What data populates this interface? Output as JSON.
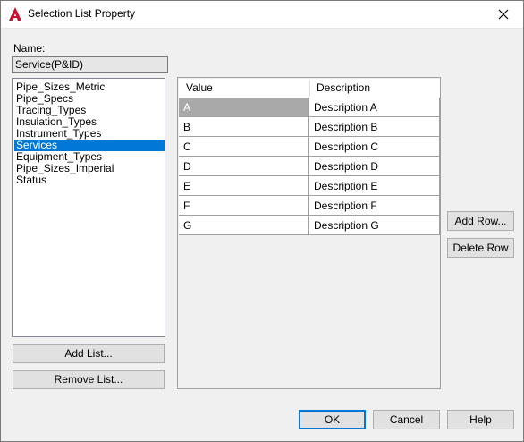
{
  "window": {
    "title": "Selection List Property"
  },
  "name_label": "Name:",
  "name_value": "Service(P&ID)",
  "lists": [
    {
      "label": "Pipe_Sizes_Metric",
      "selected": false
    },
    {
      "label": "Pipe_Specs",
      "selected": false
    },
    {
      "label": "Tracing_Types",
      "selected": false
    },
    {
      "label": "Insulation_Types",
      "selected": false
    },
    {
      "label": "Instrument_Types",
      "selected": false
    },
    {
      "label": "Services",
      "selected": true
    },
    {
      "label": "Equipment_Types",
      "selected": false
    },
    {
      "label": "Pipe_Sizes_Imperial",
      "selected": false
    },
    {
      "label": "Status",
      "selected": false
    }
  ],
  "buttons": {
    "add_list": "Add List...",
    "remove_list": "Remove List...",
    "add_row": "Add Row...",
    "delete_row": "Delete Row",
    "ok": "OK",
    "cancel": "Cancel",
    "help": "Help"
  },
  "grid": {
    "columns": [
      "Value",
      "Description"
    ],
    "rows": [
      {
        "value": "A",
        "description": "Description A"
      },
      {
        "value": "B",
        "description": "Description B"
      },
      {
        "value": "C",
        "description": "Description C"
      },
      {
        "value": "D",
        "description": "Description D"
      },
      {
        "value": "E",
        "description": "Description E"
      },
      {
        "value": "F",
        "description": "Description F"
      },
      {
        "value": "G",
        "description": "Description G"
      }
    ]
  },
  "colors": {
    "selection": "#0078d7",
    "app_icon": "#c8102e",
    "selected_cell": "#a9a9a9"
  }
}
